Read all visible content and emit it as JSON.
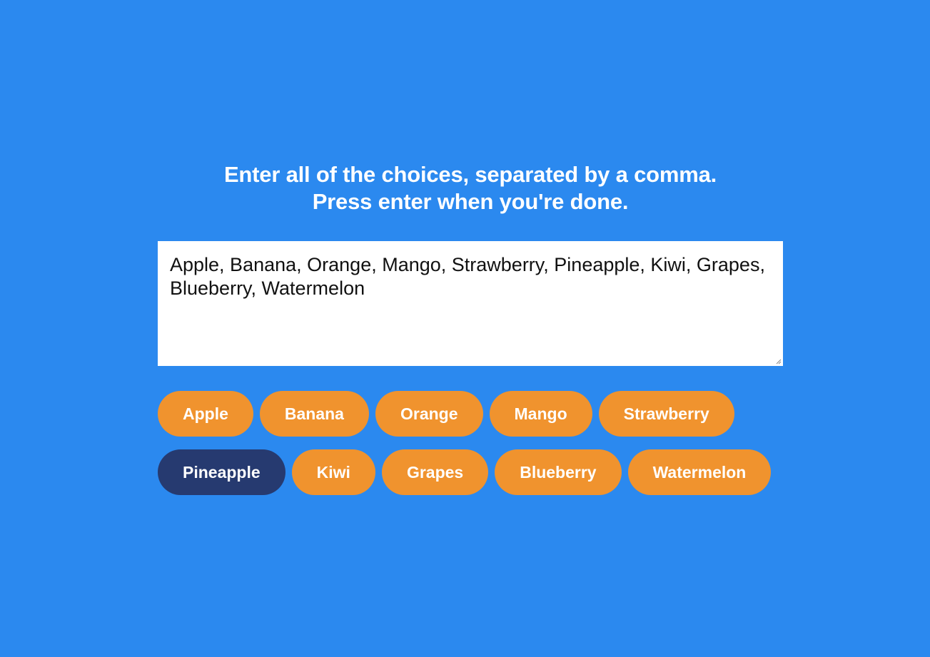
{
  "prompt": {
    "line1": "Enter all of the choices, separated by a comma.",
    "line2": "Press enter when you're done."
  },
  "input": {
    "value": "Apple, Banana, Orange, Mango, Strawberry, Pineapple, Kiwi, Grapes, Blueberry, Watermelon",
    "placeholder": ""
  },
  "choices": [
    {
      "label": "Apple",
      "selected": false
    },
    {
      "label": "Banana",
      "selected": false
    },
    {
      "label": "Orange",
      "selected": false
    },
    {
      "label": "Mango",
      "selected": false
    },
    {
      "label": "Strawberry",
      "selected": false
    },
    {
      "label": "Pineapple",
      "selected": true
    },
    {
      "label": "Kiwi",
      "selected": false
    },
    {
      "label": "Grapes",
      "selected": false
    },
    {
      "label": "Blueberry",
      "selected": false
    },
    {
      "label": "Watermelon",
      "selected": false
    }
  ],
  "colors": {
    "background": "#2b89ef",
    "chip": "#f0932e",
    "chip_selected": "#263a70",
    "text_light": "#ffffff"
  }
}
